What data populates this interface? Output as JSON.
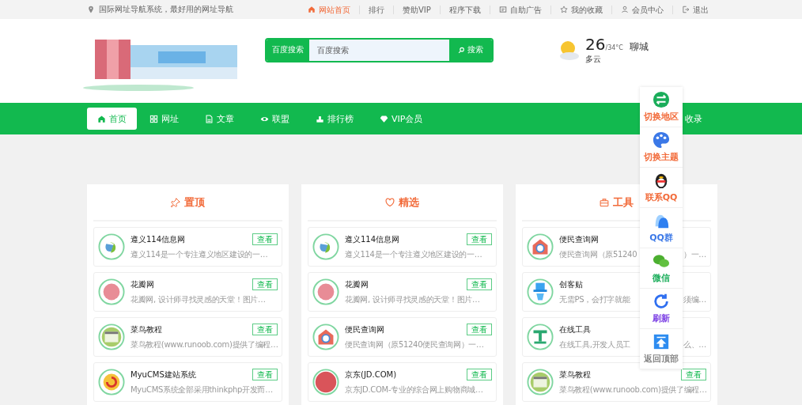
{
  "top_bar": {
    "slogan": "国际网址导航系统，最好用的网址导航",
    "links": [
      {
        "label": "网站首页",
        "kind": "home",
        "selected": true
      },
      {
        "label": "排行",
        "selected": false
      },
      {
        "label": "赞助VIP",
        "selected": false
      },
      {
        "label": "程序下载",
        "selected": false
      },
      {
        "label": "自助广告",
        "kind": "ad",
        "selected": false
      },
      {
        "label": "我的收藏",
        "kind": "star",
        "selected": false
      },
      {
        "label": "会员中心",
        "kind": "user",
        "selected": false
      },
      {
        "label": "退出",
        "kind": "exit",
        "selected": false
      }
    ]
  },
  "search": {
    "engine": "百度搜索",
    "placeholder": "百度搜索",
    "button": "搜索"
  },
  "weather": {
    "temp": "26",
    "range": "/34°C",
    "city": "聊城",
    "condition": "多云"
  },
  "nav": {
    "items": [
      {
        "label": "首页",
        "selected": true
      },
      {
        "label": "网址",
        "selected": false
      },
      {
        "label": "文章",
        "selected": false
      },
      {
        "label": "联盟",
        "selected": false
      },
      {
        "label": "排行榜",
        "selected": false
      },
      {
        "label": "VIP会员",
        "selected": false
      }
    ],
    "submit": "收录"
  },
  "cards": [
    {
      "title": "置顶",
      "items": [
        {
          "name": "遵义114信息网",
          "desc": "遵义114是一个专注遵义地区建设的一…",
          "button": "查看",
          "kind": "yi"
        },
        {
          "name": "花瓣网",
          "desc": "花瓣网, 设计师寻找灵感的天堂！图片…",
          "button": "查看",
          "kind": "petal"
        },
        {
          "name": "菜鸟教程",
          "desc": "菜鸟教程(www.runoob.com)提供了编程…",
          "button": "查看",
          "kind": "code"
        },
        {
          "name": "MyuCMS建站系统",
          "desc": "MyuCMS系统全部采用thinkphp开发而…",
          "button": "查看",
          "kind": "cms"
        }
      ]
    },
    {
      "title": "精选",
      "items": [
        {
          "name": "遵义114信息网",
          "desc": "遵义114是一个专注遵义地区建设的一…",
          "button": "查看",
          "kind": "yi"
        },
        {
          "name": "花瓣网",
          "desc": "花瓣网, 设计师寻找灵感的天堂！图片…",
          "button": "查看",
          "kind": "petal"
        },
        {
          "name": "便民查询网",
          "desc": "便民查询网（原51240便民查询网）一…",
          "button": "查看",
          "kind": "query"
        },
        {
          "name": "京东(JD.COM)",
          "desc": "京东JD.COM-专业的综合网上购物商城…",
          "button": "查看",
          "kind": "jd"
        }
      ]
    },
    {
      "title": "工具",
      "items": [
        {
          "name": "便民查询网",
          "desc": "便民查询网（原51240",
          "desc_tail": "）一…",
          "kind": "query"
        },
        {
          "name": "创客贴",
          "desc": "无需PS，会打字就能",
          "desc_tail": "须编…",
          "kind": "hat"
        },
        {
          "name": "在线工具",
          "desc": "在线工具,开发人员工",
          "desc_tail": "么、…",
          "kind": "tool"
        },
        {
          "name": "菜鸟教程",
          "desc": "菜鸟教程(www.runoob.com)提供了编程…",
          "button": "查看",
          "kind": "code"
        }
      ]
    }
  ],
  "float_bar": [
    {
      "label": "切换地区",
      "kind": "swap",
      "color": "#f26b3a"
    },
    {
      "label": "切换主题",
      "kind": "palette",
      "color": "#f26b3a"
    },
    {
      "label": "联系QQ",
      "kind": "penguin",
      "color": "#f26b3a"
    },
    {
      "label": "QQ群",
      "kind": "group",
      "color": "#3b78e7"
    },
    {
      "label": "微信",
      "kind": "wechat",
      "color": "#1aad5a"
    },
    {
      "label": "刷新",
      "kind": "refresh",
      "color": "#7b3fe4"
    },
    {
      "label": "返回顶部",
      "kind": "top",
      "color": "#888888"
    }
  ]
}
